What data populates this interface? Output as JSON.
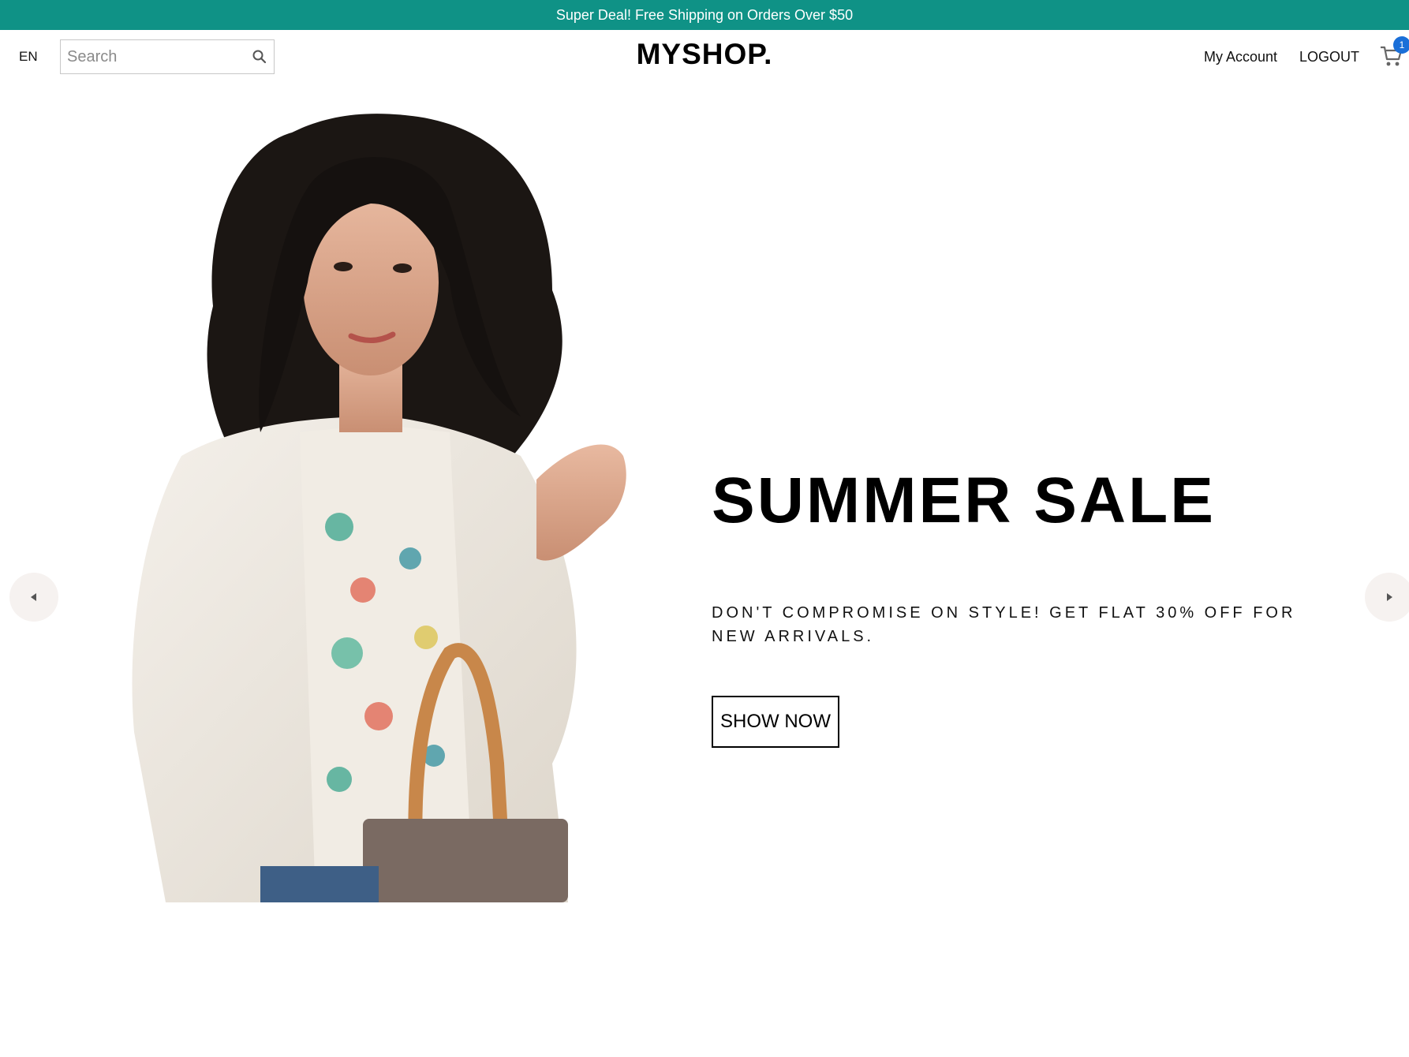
{
  "announcement": "Super Deal! Free Shipping on Orders Over $50",
  "header": {
    "language": "EN",
    "search_placeholder": "Search",
    "logo": "MYSHOP.",
    "account": "My Account",
    "logout": "LOGOUT",
    "cart_count": "1"
  },
  "hero": {
    "title": "SUMMER SALE",
    "subtitle": "DON'T COMPROMISE ON STYLE! GET FLAT 30% OFF FOR NEW ARRIVALS.",
    "button": "SHOW NOW"
  },
  "colors": {
    "brand_teal": "#0f9286",
    "badge_blue": "#1a6fd8",
    "text": "#111111"
  },
  "icons": [
    "search-icon",
    "cart-icon",
    "chevron-left-icon",
    "chevron-right-icon"
  ]
}
